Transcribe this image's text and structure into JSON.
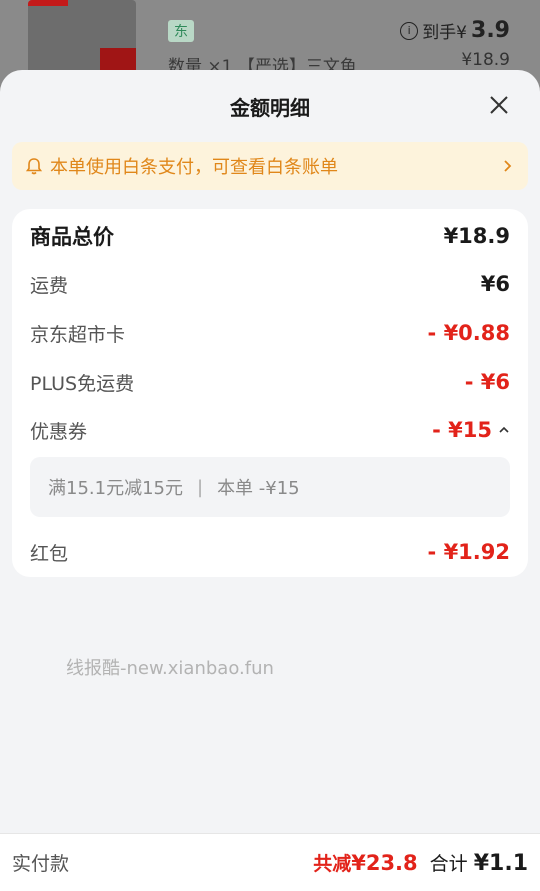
{
  "background": {
    "tag": "东",
    "quantity_text": "数量 ×1 【严选】三文鱼",
    "arrive_label": "到手¥",
    "arrive_price": "3.9",
    "price": "¥18.9"
  },
  "sheet": {
    "title": "金额明细"
  },
  "notice": {
    "text": "本单使用白条支付，可查看白条账单"
  },
  "details": {
    "total": {
      "label": "商品总价",
      "value": "¥18.9"
    },
    "shipping": {
      "label": "运费",
      "value": "¥6"
    },
    "supermarket_card": {
      "label": "京东超市卡",
      "value": "- ¥0.88"
    },
    "plus_shipping": {
      "label": "PLUS免运费",
      "value": "- ¥6"
    },
    "coupon": {
      "label": "优惠券",
      "value": "- ¥15"
    },
    "coupon_detail": {
      "rule": "满15.1元减15元",
      "separator": "|",
      "applied": "本单 -¥15"
    },
    "red_packet": {
      "label": "红包",
      "value": "- ¥1.92"
    }
  },
  "watermark": "线报酷-new.xianbao.fun",
  "footer": {
    "paid_label": "实付款",
    "saved_label": "共减",
    "saved_value": "¥23.8",
    "total_label": "合计",
    "total_value": "¥1.1"
  },
  "colors": {
    "accent_red": "#e2231a",
    "notice_text": "#e0871a",
    "notice_bg": "#fdf3dc"
  },
  "icons": [
    "info-icon",
    "close-icon",
    "bell-icon",
    "chevron-right-icon",
    "chevron-up-icon"
  ]
}
